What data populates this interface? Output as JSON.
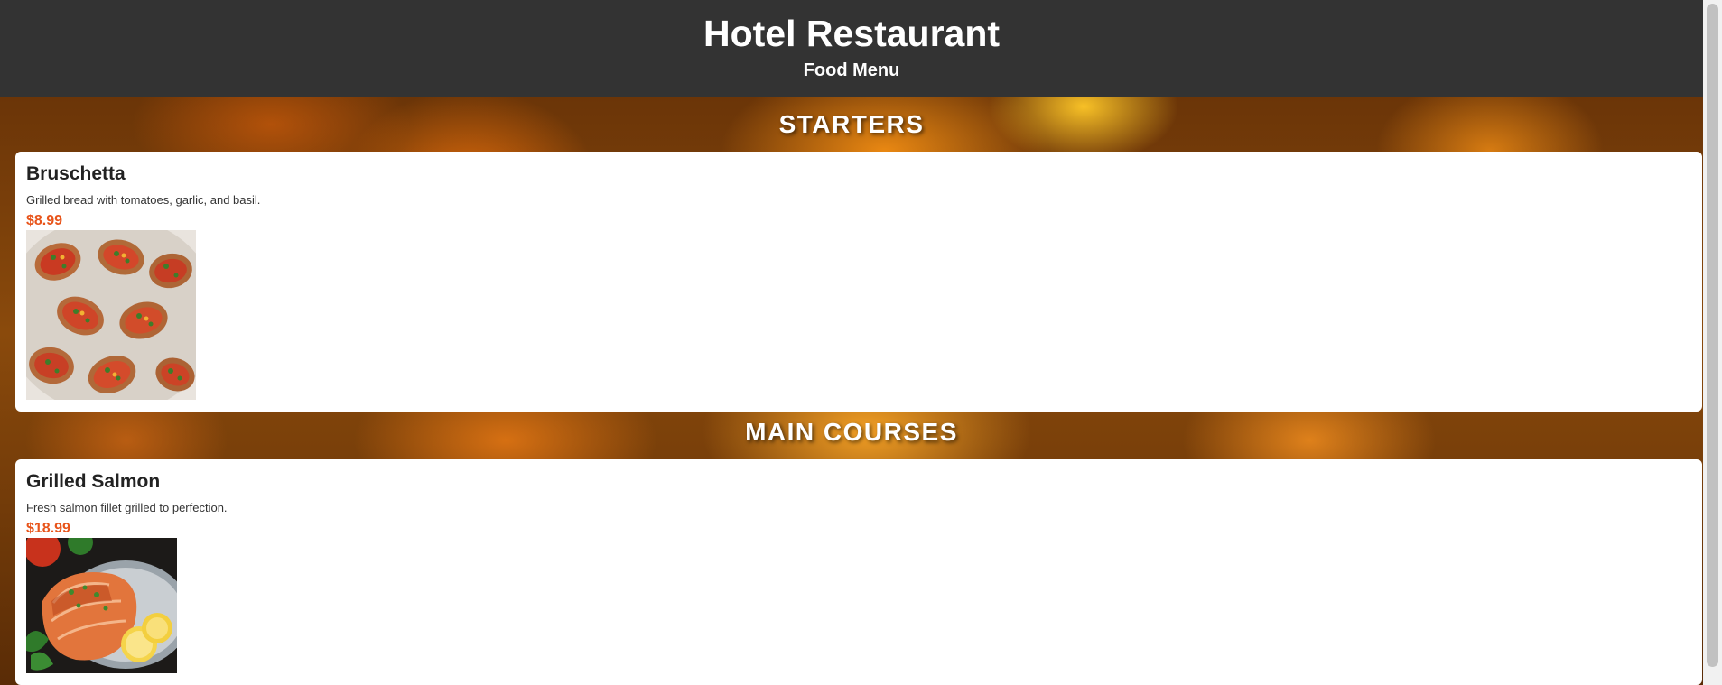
{
  "header": {
    "title": "Hotel Restaurant",
    "subtitle": "Food Menu"
  },
  "sections": [
    {
      "title": "STARTERS",
      "items": [
        {
          "name": "Bruschetta",
          "description": "Grilled bread with tomatoes, garlic, and basil.",
          "price": "$8.99",
          "image": "bruschetta-photo"
        }
      ]
    },
    {
      "title": "MAIN COURSES",
      "items": [
        {
          "name": "Grilled Salmon",
          "description": "Fresh salmon fillet grilled to perfection.",
          "price": "$18.99",
          "image": "grilled-salmon-photo"
        }
      ]
    }
  ],
  "colors": {
    "header_bg": "#333333",
    "price": "#e8541a",
    "card_bg": "#ffffff"
  }
}
